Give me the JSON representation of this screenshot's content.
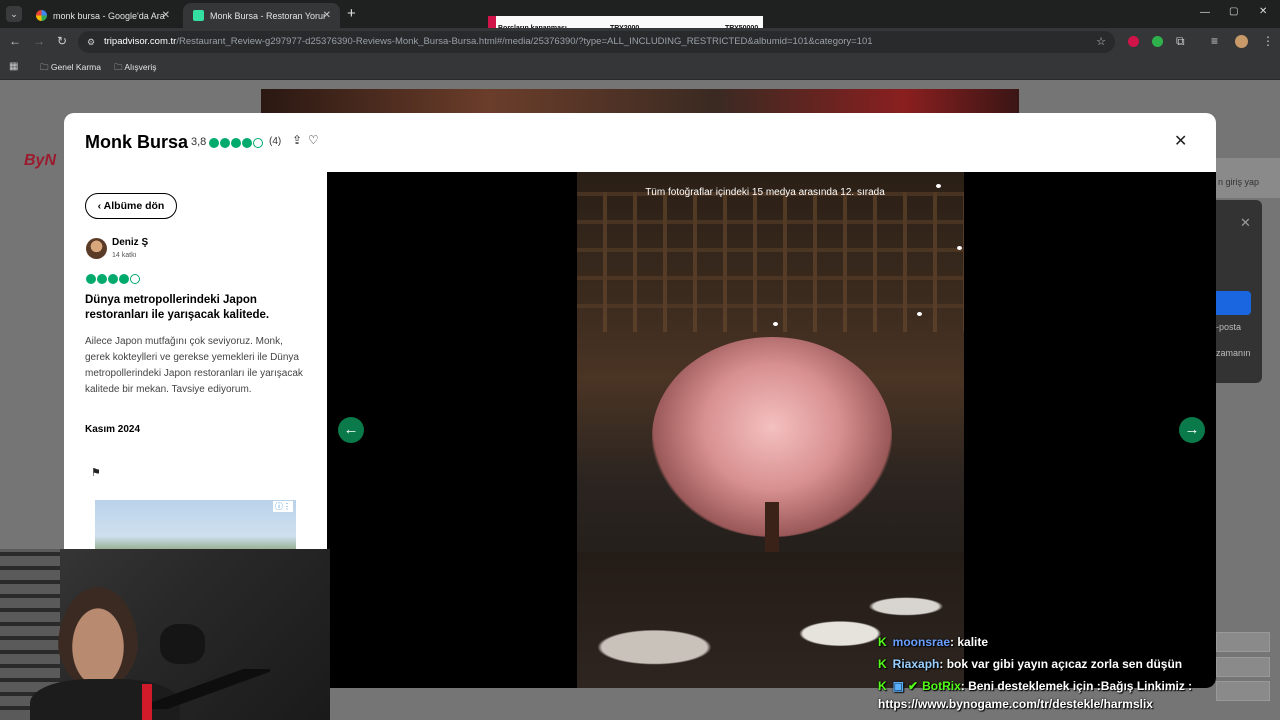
{
  "browser": {
    "tabs": [
      {
        "title": "monk bursa - Google'da Ara",
        "active": false
      },
      {
        "title": "Monk Bursa - Restoran Yorumla",
        "active": true
      }
    ],
    "new_tab": "+",
    "url_host": "tripadvisor.com.tr",
    "url_path": "/Restaurant_Review-g297977-d25376390-Reviews-Monk_Bursa-Bursa.html#/media/25376390/?type=ALL_INCLUDING_RESTRICTED&albumid=101&category=101",
    "bookmarks": [
      "Genel Karma",
      "Alışveriş"
    ],
    "window_controls": [
      "—",
      "▢",
      "✕"
    ]
  },
  "overlay_strip": {
    "label": "Borçların kapanması",
    "value1": "TRY2000",
    "value2": "TRY50000"
  },
  "background_page": {
    "logo": "ByN",
    "login_hint": "n giriş yap",
    "posta": "-posta",
    "zamanin": "zamanın"
  },
  "modal": {
    "title": "Monk Bursa",
    "rating_value": "3,8",
    "rating_bubbles": 4,
    "review_count": "(4)",
    "back_button": "Albüme dön",
    "reviewer_name": "Deniz Ş",
    "reviewer_contrib": "14 katkı",
    "review_rating": 4,
    "review_title": "Dünya metropollerindeki Japon restoranları ile yarışacak kalitede.",
    "review_body": "Ailece Japon mutfağını çok seviyoruz. Monk, gerek kokteylleri ve gerekse yemekleri ile Dünya metropollerindeki Japon restoranları ile yarışacak kalitede bir mekan. Tavsiye ediyorum.",
    "review_date": "Kasım 2024",
    "media_counter": "Tüm fotoğraflar içindeki 15 medya arasında 12. sırada"
  },
  "chat": [
    {
      "user": "moonsrae",
      "message": ": kalite"
    },
    {
      "user": "Riaxaph",
      "message": ": bok var gibi yayın açıcaz zorla sen düşün"
    },
    {
      "user": "BotRix",
      "message": ": Beni desteklemek için :Bağış Linkimiz :"
    },
    {
      "user": "",
      "message": "https://www.bynogame.com/tr/destekle/harmslix"
    }
  ],
  "colors": {
    "accent": "#00aa6c",
    "nav_button": "#0b7a4a",
    "kick_green": "#53fc18"
  }
}
